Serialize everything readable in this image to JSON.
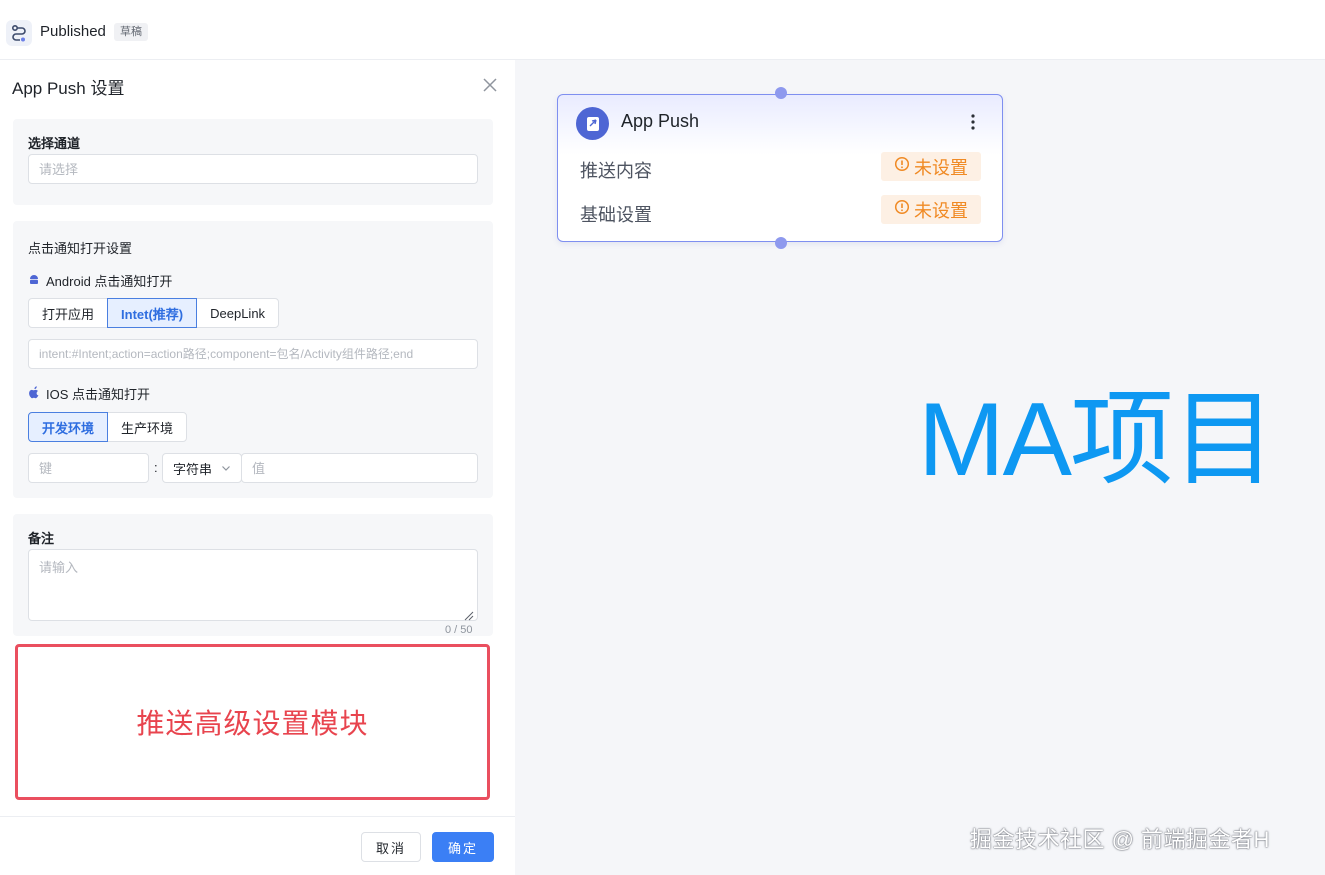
{
  "header": {
    "title": "Published",
    "badge": "草稿"
  },
  "panel": {
    "title": "App Push 设置",
    "channel": {
      "label": "选择通道",
      "placeholder": "请选择"
    },
    "click_settings": {
      "label": "点击通知打开设置",
      "android": {
        "label": "Android 点击通知打开",
        "options": [
          "打开应用",
          "Intet(推荐)",
          "DeepLink"
        ],
        "selected": "Intet(推荐)",
        "placeholder": "intent:#Intent;action=action路径;component=包名/Activity组件路径;end"
      },
      "ios": {
        "label": "IOS 点击通知打开",
        "options": [
          "开发环境",
          "生产环境"
        ],
        "selected": "开发环境",
        "key_placeholder": "键",
        "separator": ":",
        "type_value": "字符串",
        "value_placeholder": "值"
      }
    },
    "remark": {
      "label": "备注",
      "placeholder": "请输入",
      "counter": "0 / 50"
    },
    "advanced": {
      "text": "推送高级设置模块"
    },
    "footer": {
      "cancel": "取消",
      "ok": "确定"
    }
  },
  "canvas": {
    "node": {
      "title": "App Push",
      "rows": [
        {
          "label": "推送内容",
          "status": "未设置"
        },
        {
          "label": "基础设置",
          "status": "未设置"
        }
      ]
    },
    "watermark_big": "MA项目",
    "watermark_small": "掘金技术社区 @ 前端掘金者H"
  },
  "colors": {
    "accent": "#3b7ff5",
    "warning": "#f08a24",
    "highlight_border": "#ea4f5f",
    "node_border": "#7f8ff0",
    "watermark": "#0e98f2"
  },
  "icons": {
    "logo": "flow-logo-icon",
    "close": "close-icon",
    "android": "android-icon",
    "ios": "apple-icon",
    "chevron": "chevron-down-icon",
    "node": "send-icon",
    "more": "more-vertical-icon",
    "status": "exclamation-circle-icon"
  }
}
